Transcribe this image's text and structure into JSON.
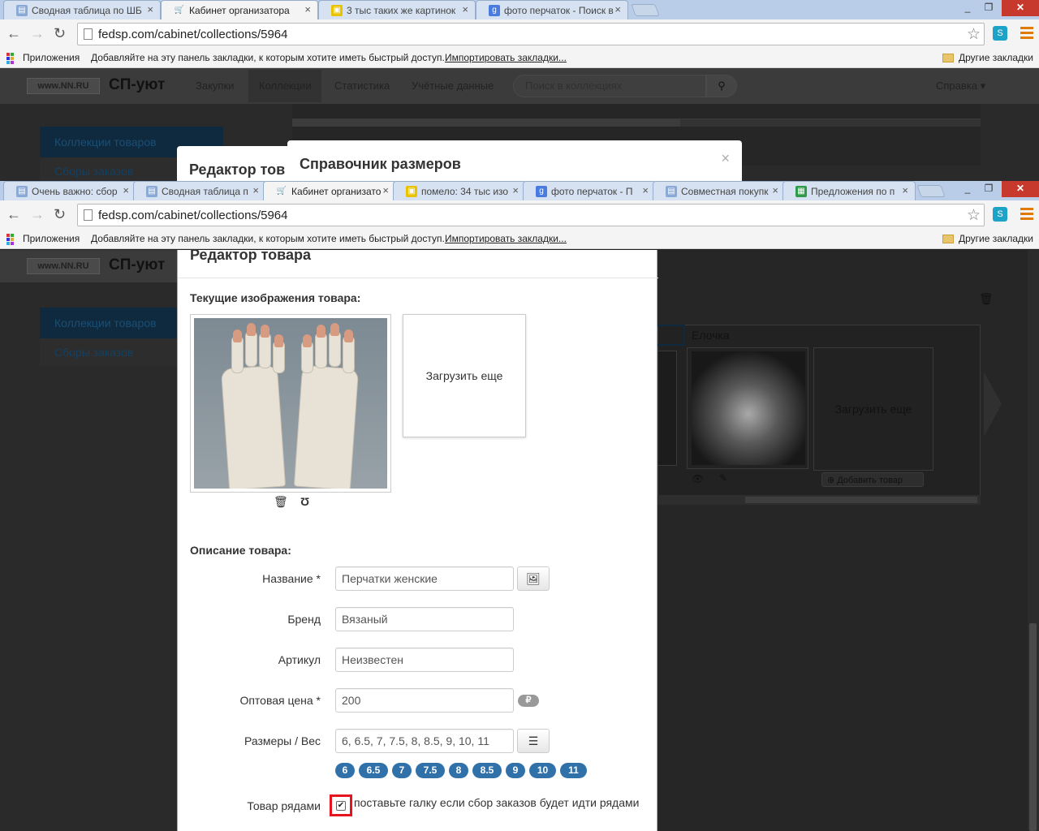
{
  "browser_top": {
    "tabs": [
      {
        "title": "Сводная таблица по ШБ",
        "favicon": "doc"
      },
      {
        "title": "Кабинет организатора",
        "favicon": "cart",
        "active": true
      },
      {
        "title": "3 тыс таких же картинок",
        "favicon": "pics"
      },
      {
        "title": "фото перчаток - Поиск в",
        "favicon": "google"
      }
    ],
    "url": "fedsp.com/cabinet/collections/5964"
  },
  "browser_main": {
    "tabs": [
      {
        "title": "Очень важно: сбор",
        "favicon": "doc"
      },
      {
        "title": "Сводная таблица п",
        "favicon": "doc"
      },
      {
        "title": "Кабинет организато",
        "favicon": "cart",
        "active": true
      },
      {
        "title": "помело: 34 тыс изо",
        "favicon": "pics"
      },
      {
        "title": "фото перчаток - П",
        "favicon": "google"
      },
      {
        "title": "Совместная покупк",
        "favicon": "doc"
      },
      {
        "title": "Предложения по п",
        "favicon": "sheet"
      }
    ],
    "url": "fedsp.com/cabinet/collections/5964"
  },
  "bookmarks": {
    "apps": "Приложения",
    "hint": "Добавляйте на эту панель закладки, к которым хотите иметь быстрый доступ.",
    "import": "Импортировать закладки...",
    "other": "Другие закладки"
  },
  "site": {
    "logo": "www.NN.RU",
    "brand": "СП-уют",
    "nav": [
      "Закупки",
      "Коллекции",
      "Статистика",
      "Учётные данные"
    ],
    "search_placeholder": "Поиск в коллекциях",
    "help": "Справка ▾",
    "side": [
      "Коллекции товаров",
      "Сборы заказов"
    ]
  },
  "overlays": {
    "editor_title_partial": "Редактор тов",
    "sizes_title": "Справочник размеров",
    "close": "×"
  },
  "editor": {
    "title": "Редактор товара",
    "images_label": "Текущие изображения товара:",
    "upload_more": "Загрузить еще",
    "desc_label": "Описание товара:",
    "fields": {
      "name_label": "Название *",
      "name_value": "Перчатки женские",
      "brand_label": "Бренд",
      "brand_value": "Вязаный",
      "article_label": "Артикул",
      "article_value": "Неизвестен",
      "price_label": "Оптовая цена *",
      "price_value": "200",
      "currency": "₽",
      "sizes_label": "Размеры / Вес",
      "sizes_value": "6, 6.5, 7, 7.5, 8, 8.5, 9, 10, 11"
    },
    "size_chips": [
      "6",
      "6.5",
      "7",
      "7.5",
      "8",
      "8.5",
      "9",
      "10",
      "11"
    ],
    "rows_label": "Товар рядами",
    "rows_checked": true,
    "rows_hint": "поставьте галку если сбор заказов будет идти рядами"
  },
  "background": {
    "card_name": "Елочка",
    "upload_more": "Загрузить еще",
    "add_item": "Добавить товар"
  }
}
